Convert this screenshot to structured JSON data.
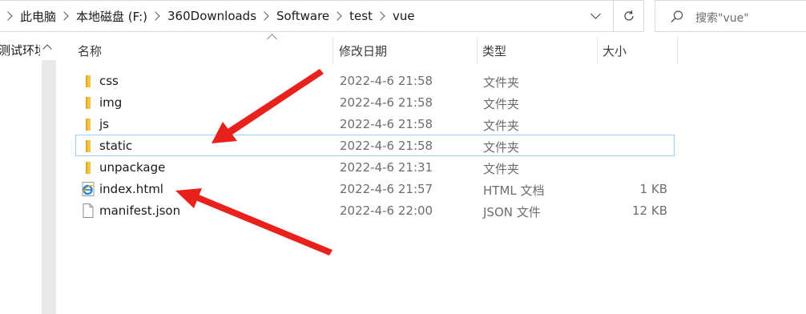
{
  "breadcrumb": {
    "items": [
      "此电脑",
      "本地磁盘 (F:)",
      "360Downloads",
      "Software",
      "test",
      "vue"
    ]
  },
  "search": {
    "placeholder": "搜索\"vue\""
  },
  "navpane": {
    "label": "测试环境"
  },
  "columns": {
    "name": "名称",
    "date": "修改日期",
    "type": "类型",
    "size": "大小"
  },
  "files": [
    {
      "name": "css",
      "date": "2022-4-6 21:58",
      "type": "文件夹",
      "size": "",
      "icon": "folder-icon",
      "selected": false
    },
    {
      "name": "img",
      "date": "2022-4-6 21:58",
      "type": "文件夹",
      "size": "",
      "icon": "folder-icon",
      "selected": false
    },
    {
      "name": "js",
      "date": "2022-4-6 21:58",
      "type": "文件夹",
      "size": "",
      "icon": "folder-icon",
      "selected": false
    },
    {
      "name": "static",
      "date": "2022-4-6 21:58",
      "type": "文件夹",
      "size": "",
      "icon": "folder-icon",
      "selected": true
    },
    {
      "name": "unpackage",
      "date": "2022-4-6 21:31",
      "type": "文件夹",
      "size": "",
      "icon": "folder-icon",
      "selected": false
    },
    {
      "name": "index.html",
      "date": "2022-4-6 21:57",
      "type": "HTML 文档",
      "size": "1 KB",
      "icon": "ie-html-icon",
      "selected": false
    },
    {
      "name": "manifest.json",
      "date": "2022-4-6 22:00",
      "type": "JSON 文件",
      "size": "12 KB",
      "icon": "file-icon",
      "selected": false
    }
  ],
  "colors": {
    "folder": "#f5c342",
    "folder_dark": "#e0a82e",
    "selection_border": "#99d1ff",
    "arrow": "#e8211c",
    "ie_blue": "#1e7fd6"
  }
}
